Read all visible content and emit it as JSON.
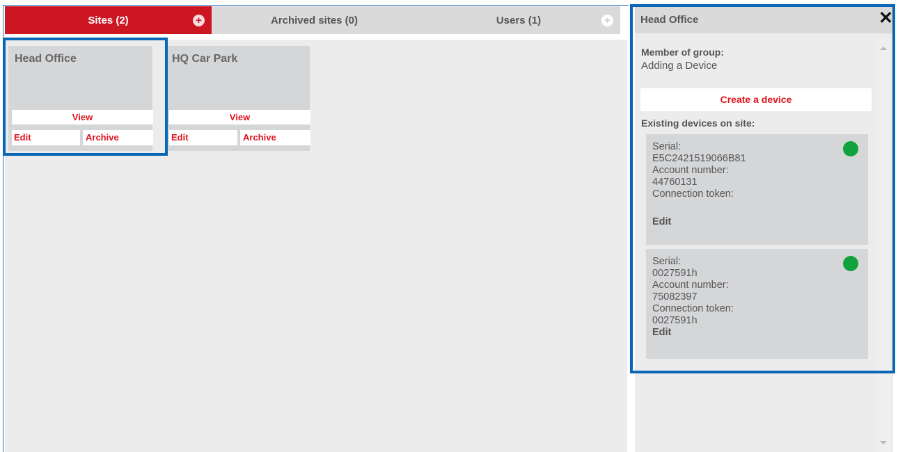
{
  "tabs": {
    "sites_label": "Sites (2)",
    "archived_label": "Archived sites (0)",
    "users_label": "Users (1)"
  },
  "sites": [
    {
      "name": "Head Office",
      "view": "View",
      "edit": "Edit",
      "archive": "Archive"
    },
    {
      "name": "HQ Car Park",
      "view": "View",
      "edit": "Edit",
      "archive": "Archive"
    }
  ],
  "panel": {
    "title": "Head Office",
    "close_glyph": "✕",
    "member_label": "Member of group:",
    "member_value": "Adding a Device",
    "create_device": "Create a device",
    "existing_label": "Existing devices on site:",
    "devices": [
      {
        "serial_label": "Serial:",
        "serial": "E5C2421519066B81",
        "account_label": "Account number:",
        "account": "44760131",
        "token_label": "Connection token:",
        "token": "",
        "edit": "Edit",
        "status_color": "#12a23c"
      },
      {
        "serial_label": "Serial:",
        "serial": "0027591h",
        "account_label": "Account number:",
        "account": "75082397",
        "token_label": "Connection token:",
        "token": "0027591h",
        "edit": "Edit",
        "status_color": "#12a23c"
      }
    ]
  },
  "colors": {
    "accent": "#cc1622",
    "link": "#e0141e",
    "highlight": "#0a67b8",
    "status_ok": "#12a23c"
  }
}
